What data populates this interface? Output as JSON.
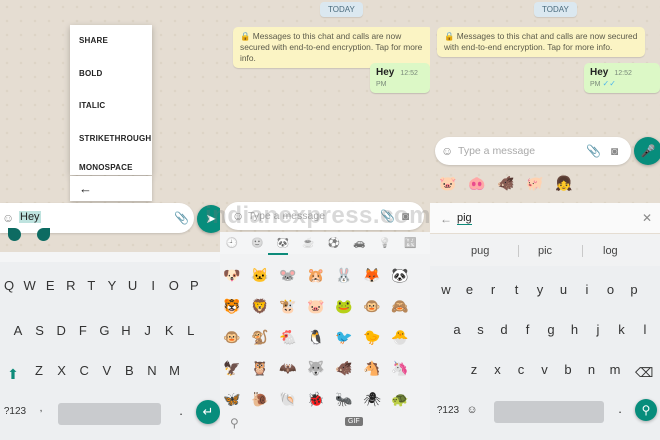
{
  "panel1": {
    "menu": [
      "SHARE",
      "BOLD",
      "ITALIC",
      "STRIKETHROUGH",
      "MONOSPACE"
    ],
    "back_icon": "←",
    "input_text": "Hey",
    "send_icon": "➤"
  },
  "panel2": {
    "today": "TODAY",
    "notice": "🔒 Messages to this chat and calls are now secured with end-to-end encryption. Tap for more info.",
    "msg_text": "Hey",
    "msg_time": "12:52 PM",
    "placeholder": "Type a message",
    "gif": "GIF",
    "tab_icons": [
      "🕘",
      "🙂",
      "🐼",
      "☕",
      "⚽",
      "🚗",
      "💡",
      "🔣"
    ],
    "emojis": [
      [
        "🐶",
        "🐱",
        "🐭",
        "🐹",
        "🐰",
        "🦊",
        "🐼"
      ],
      [
        "🐯",
        "🦁",
        "🐮",
        "🐷",
        "🐸",
        "🐵",
        "🙈"
      ],
      [
        "🐵",
        "🐒",
        "🐔",
        "🐧",
        "🐦",
        "🐤",
        "🐣"
      ],
      [
        "🦅",
        "🦉",
        "🦇",
        "🐺",
        "🐗",
        "🐴",
        "🦄"
      ],
      [
        "🦋",
        "🐌",
        "🐚",
        "🐞",
        "🐜",
        "🕷",
        "🐢"
      ]
    ]
  },
  "panel3": {
    "today": "TODAY",
    "notice": "🔒 Messages to this chat and calls are now secured with end-to-end encryption. Tap for more info.",
    "msg_text": "Hey",
    "msg_time": "12:52 PM",
    "placeholder": "Type a message",
    "emoji_suggestions": [
      "🐷",
      "🐽",
      "🐗",
      "🐖",
      "👧"
    ],
    "search_text": "pig",
    "suggestions": [
      "pug",
      "pic",
      "log"
    ]
  },
  "keyboard": {
    "row1": [
      "Q",
      "W",
      "E",
      "R",
      "T",
      "Y",
      "U",
      "I",
      "O",
      "P"
    ],
    "row2": [
      "A",
      "S",
      "D",
      "F",
      "G",
      "H",
      "J",
      "K",
      "L"
    ],
    "row3": [
      "Z",
      "X",
      "C",
      "V",
      "B",
      "N",
      "M"
    ],
    "row1_p3": [
      "w",
      "e",
      "r",
      "t",
      "y",
      "u",
      "i",
      "o",
      "p"
    ],
    "row2_p3": [
      "a",
      "s",
      "d",
      "f",
      "g",
      "h",
      "j",
      "k",
      "l"
    ],
    "row3_p3": [
      "z",
      "x",
      "c",
      "v",
      "b",
      "n",
      "m"
    ],
    "sym_label": "?123"
  },
  "watermark": "indianexpress.com"
}
